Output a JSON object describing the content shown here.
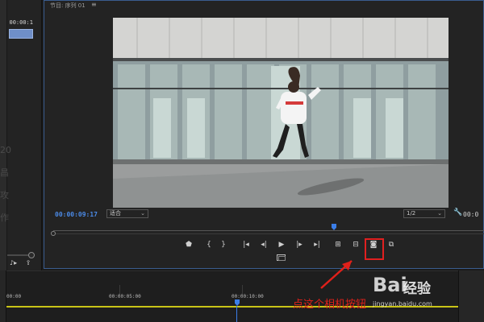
{
  "project": {
    "clip_timecode": "00:00:1",
    "ghost_chars": [
      "20",
      "昌",
      "攻",
      "作"
    ],
    "bottom_icons": [
      "♪▸",
      "⇪"
    ]
  },
  "monitor": {
    "title": "节目: 序列 01",
    "menu_icon": "≡",
    "current_timecode": "00:00:09:17",
    "fit_label": "适合",
    "resolution_label": "1/2",
    "chevron": "⌄",
    "wrench_icon": "🔧",
    "end_timecode": "00:0"
  },
  "controls": [
    {
      "name": "add-marker",
      "glyph": "⬟"
    },
    {
      "name": "mark-in",
      "glyph": "{"
    },
    {
      "name": "mark-out",
      "glyph": "}"
    },
    {
      "name": "go-to-in",
      "glyph": "|◂"
    },
    {
      "name": "step-back",
      "glyph": "◂|"
    },
    {
      "name": "play",
      "glyph": "▶"
    },
    {
      "name": "step-forward",
      "glyph": "|▸"
    },
    {
      "name": "go-to-out",
      "glyph": "▸|"
    },
    {
      "name": "lift",
      "glyph": "⊞"
    },
    {
      "name": "extract",
      "glyph": "⊟"
    },
    {
      "name": "export-frame",
      "glyph": "◙"
    },
    {
      "name": "comparison-view",
      "glyph": "⧉"
    }
  ],
  "timeline": {
    "ticks": [
      "00:00",
      "00:00:05:00",
      "00:00:10:00"
    ]
  },
  "annotation": {
    "text": "点这个相机按钮"
  },
  "watermark": {
    "logo": "Bai",
    "text": "经验",
    "url": "jingyan.baidu.com"
  },
  "colors": {
    "accent_blue": "#4b8ae6",
    "highlight_red": "#e02020",
    "timeline_yellow": "#c9c317"
  }
}
